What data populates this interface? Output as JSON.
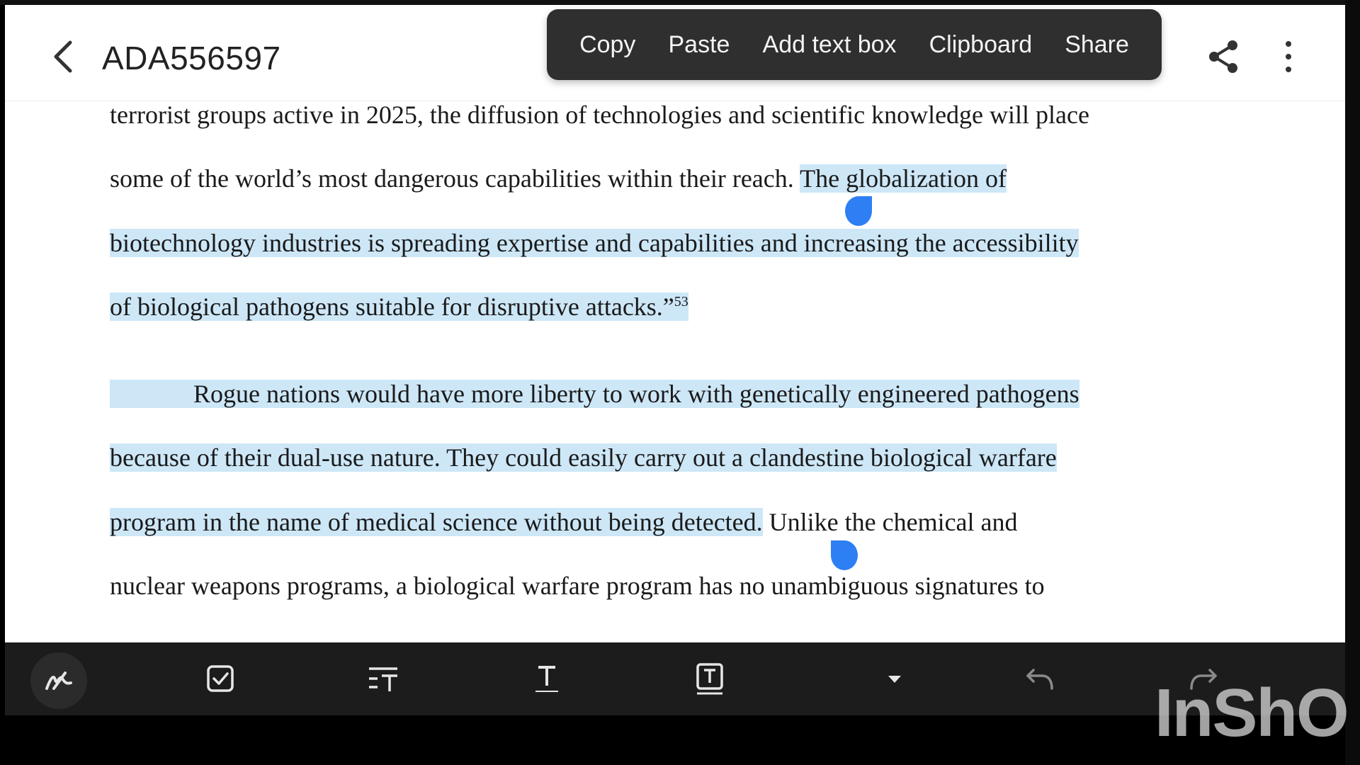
{
  "header": {
    "title": "ADA556597",
    "back_icon": "chevron-left-icon",
    "share_icon": "share-icon",
    "more_icon": "more-vertical-icon"
  },
  "context_menu": {
    "items": [
      "Copy",
      "Paste",
      "Add text box",
      "Clipboard",
      "Share"
    ]
  },
  "document": {
    "line1": "terrorist groups active in 2025, the diffusion of technologies and scientific knowledge will place",
    "line2_plain": "some of the world’s most dangerous capabilities within their reach. ",
    "line2_hl": "The globalization of",
    "line3_hl": "biotechnology industries is spreading expertise and capabilities and increasing the accessibility",
    "line4_hl": "of biological pathogens suitable for disruptive attacks.”",
    "line4_sup": "53",
    "line5_hl": "Rogue nations would have more liberty to work with genetically engineered pathogens",
    "line6_hl": "because of their dual-use nature.  They could easily carry out a clandestine biological warfare",
    "line7_hl": "program in the name of medical science without being detected.",
    "line7_plain": " Unlike the chemical and",
    "line8": "nuclear weapons programs, a biological warfare program has no unambiguous signatures to"
  },
  "toolbar": {
    "icons": [
      "pen-icon",
      "checkbox-icon",
      "text-align-icon",
      "text-icon",
      "text-box-icon",
      "dropdown-arrow-icon",
      "undo-icon",
      "redo-icon"
    ]
  },
  "watermark": "InShO",
  "colors": {
    "highlight": "#cde7f7",
    "handle": "#2d7ff3",
    "menu_bg": "#2f2f2f",
    "toolbar_bg": "#1c1c1c"
  }
}
